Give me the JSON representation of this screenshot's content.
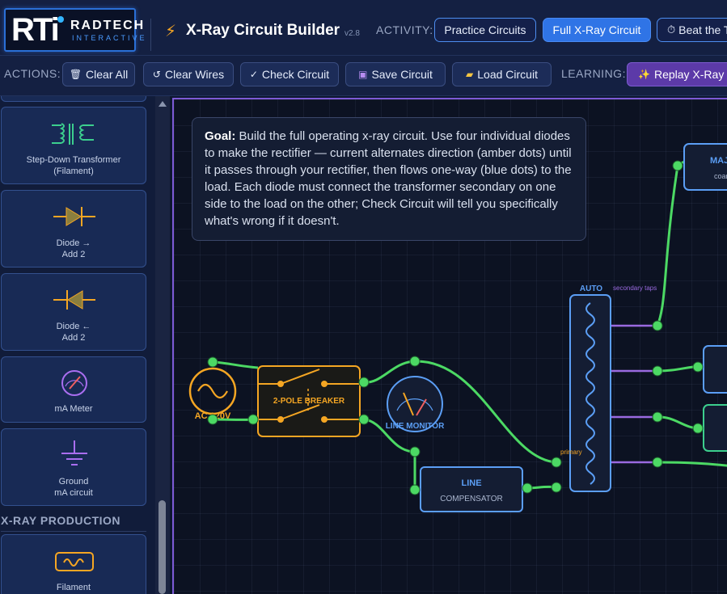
{
  "header": {
    "logo": {
      "mark": "RTi",
      "name": "RADTECH",
      "subtitle": "INTERACTIVE"
    },
    "title": "X-Ray Circuit Builder",
    "version": "v2.8",
    "activity_label": "ACTIVITY:",
    "activity_tabs": [
      {
        "label": "Practice Circuits",
        "active": false
      },
      {
        "label": "Full X-Ray Circuit",
        "active": true
      },
      {
        "label": "Beat the T",
        "active": false,
        "icon": "stopwatch-icon"
      }
    ]
  },
  "toolbar": {
    "actions_label": "ACTIONS:",
    "buttons": [
      {
        "label": "Clear All",
        "icon": "trash-icon"
      },
      {
        "label": "Clear Wires",
        "icon": "refresh-icon"
      },
      {
        "label": "Check Circuit",
        "icon": "check-icon"
      },
      {
        "label": "Save Circuit",
        "icon": "save-icon"
      },
      {
        "label": "Load Circuit",
        "icon": "folder-icon"
      }
    ],
    "learning_label": "LEARNING:",
    "learning_button": {
      "label": "Replay X-Ray",
      "icon": "sparkles-icon"
    }
  },
  "sidebar": {
    "components": [
      {
        "label": "Step-Down Transformer",
        "sub": "(Filament)",
        "icon": "transformer-icon"
      },
      {
        "label": "Diode →",
        "sub": "Add 2",
        "icon": "diode-forward-icon"
      },
      {
        "label": "Diode ←",
        "sub": "Add 2",
        "icon": "diode-reverse-icon"
      },
      {
        "label": "mA Meter",
        "sub": "",
        "icon": "ma-meter-icon"
      },
      {
        "label": "Ground",
        "sub": "mA circuit",
        "icon": "ground-icon"
      }
    ],
    "section_title": "X-RAY PRODUCTION",
    "production_components": [
      {
        "label": "Filament",
        "icon": "filament-icon"
      }
    ]
  },
  "goal": {
    "heading": "Goal:",
    "text": "Build the full operating x-ray circuit. Use four individual diodes to make the rectifier — current alternates direction (amber dots) until it passes through your rectifier, then flows one-way (blue dots) to the load. Each diode must connect the transformer secondary on one side to the load on the other; Check Circuit will tell you specifically what's wrong if it doesn't."
  },
  "circuit": {
    "ac_source": "AC 120V",
    "breaker": "2-POLE BREAKER",
    "line_monitor": "LINE MONITOR",
    "line_compensator": {
      "title": "LINE",
      "subtitle": "COMPENSATOR"
    },
    "autotransformer": {
      "title": "AUTO",
      "taps_label": "secondary taps",
      "primary_label": "primary"
    },
    "major_selector": {
      "title": "MAJ",
      "subtitle": "coar"
    }
  },
  "colors": {
    "wire": "#4cd964",
    "component": "#f5a623",
    "instrument": "#5b9ef5",
    "tap_wire": "#9a6ae0",
    "accent": "#2f74e6",
    "canvas_border": "#7d5ad6"
  }
}
